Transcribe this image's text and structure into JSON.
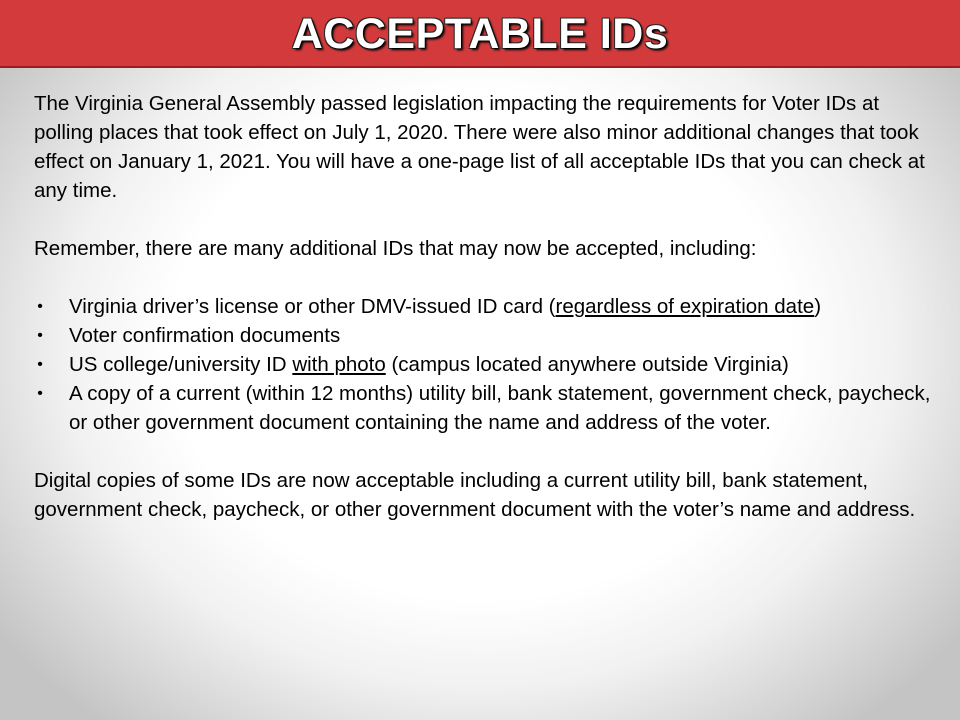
{
  "slide": {
    "title": "ACCEPTABLE IDs",
    "intro": "The Virginia General Assembly passed legislation impacting the requirements for Voter IDs at polling places that took effect on July 1, 2020. There were also minor additional changes that took effect on January 1, 2021. You will have a one-page list of all acceptable IDs that you can check at any time.",
    "remember": "Remember, there are many additional IDs that may now be accepted, including:",
    "bullet_symbol": "•",
    "bullets": [
      {
        "pre": "Virginia driver’s license or other DMV-issued ID card (",
        "underlined": "regardless of expiration date",
        "post": ")"
      },
      {
        "text": "Voter confirmation documents"
      },
      {
        "pre": "US college/university ID ",
        "underlined": "with photo",
        "post": " (campus located anywhere outside Virginia)"
      },
      {
        "text": "A copy of a current (within 12 months) utility bill, bank statement, government check, paycheck, or other government document containing the name and address of the voter."
      }
    ],
    "closing": "Digital copies of some IDs are now acceptable including a current utility bill, bank statement, government check, paycheck, or other government document with the voter’s name and address."
  },
  "colors": {
    "title_bar": "#d23a3b",
    "title_text": "#ffffff",
    "body_text": "#000000"
  }
}
